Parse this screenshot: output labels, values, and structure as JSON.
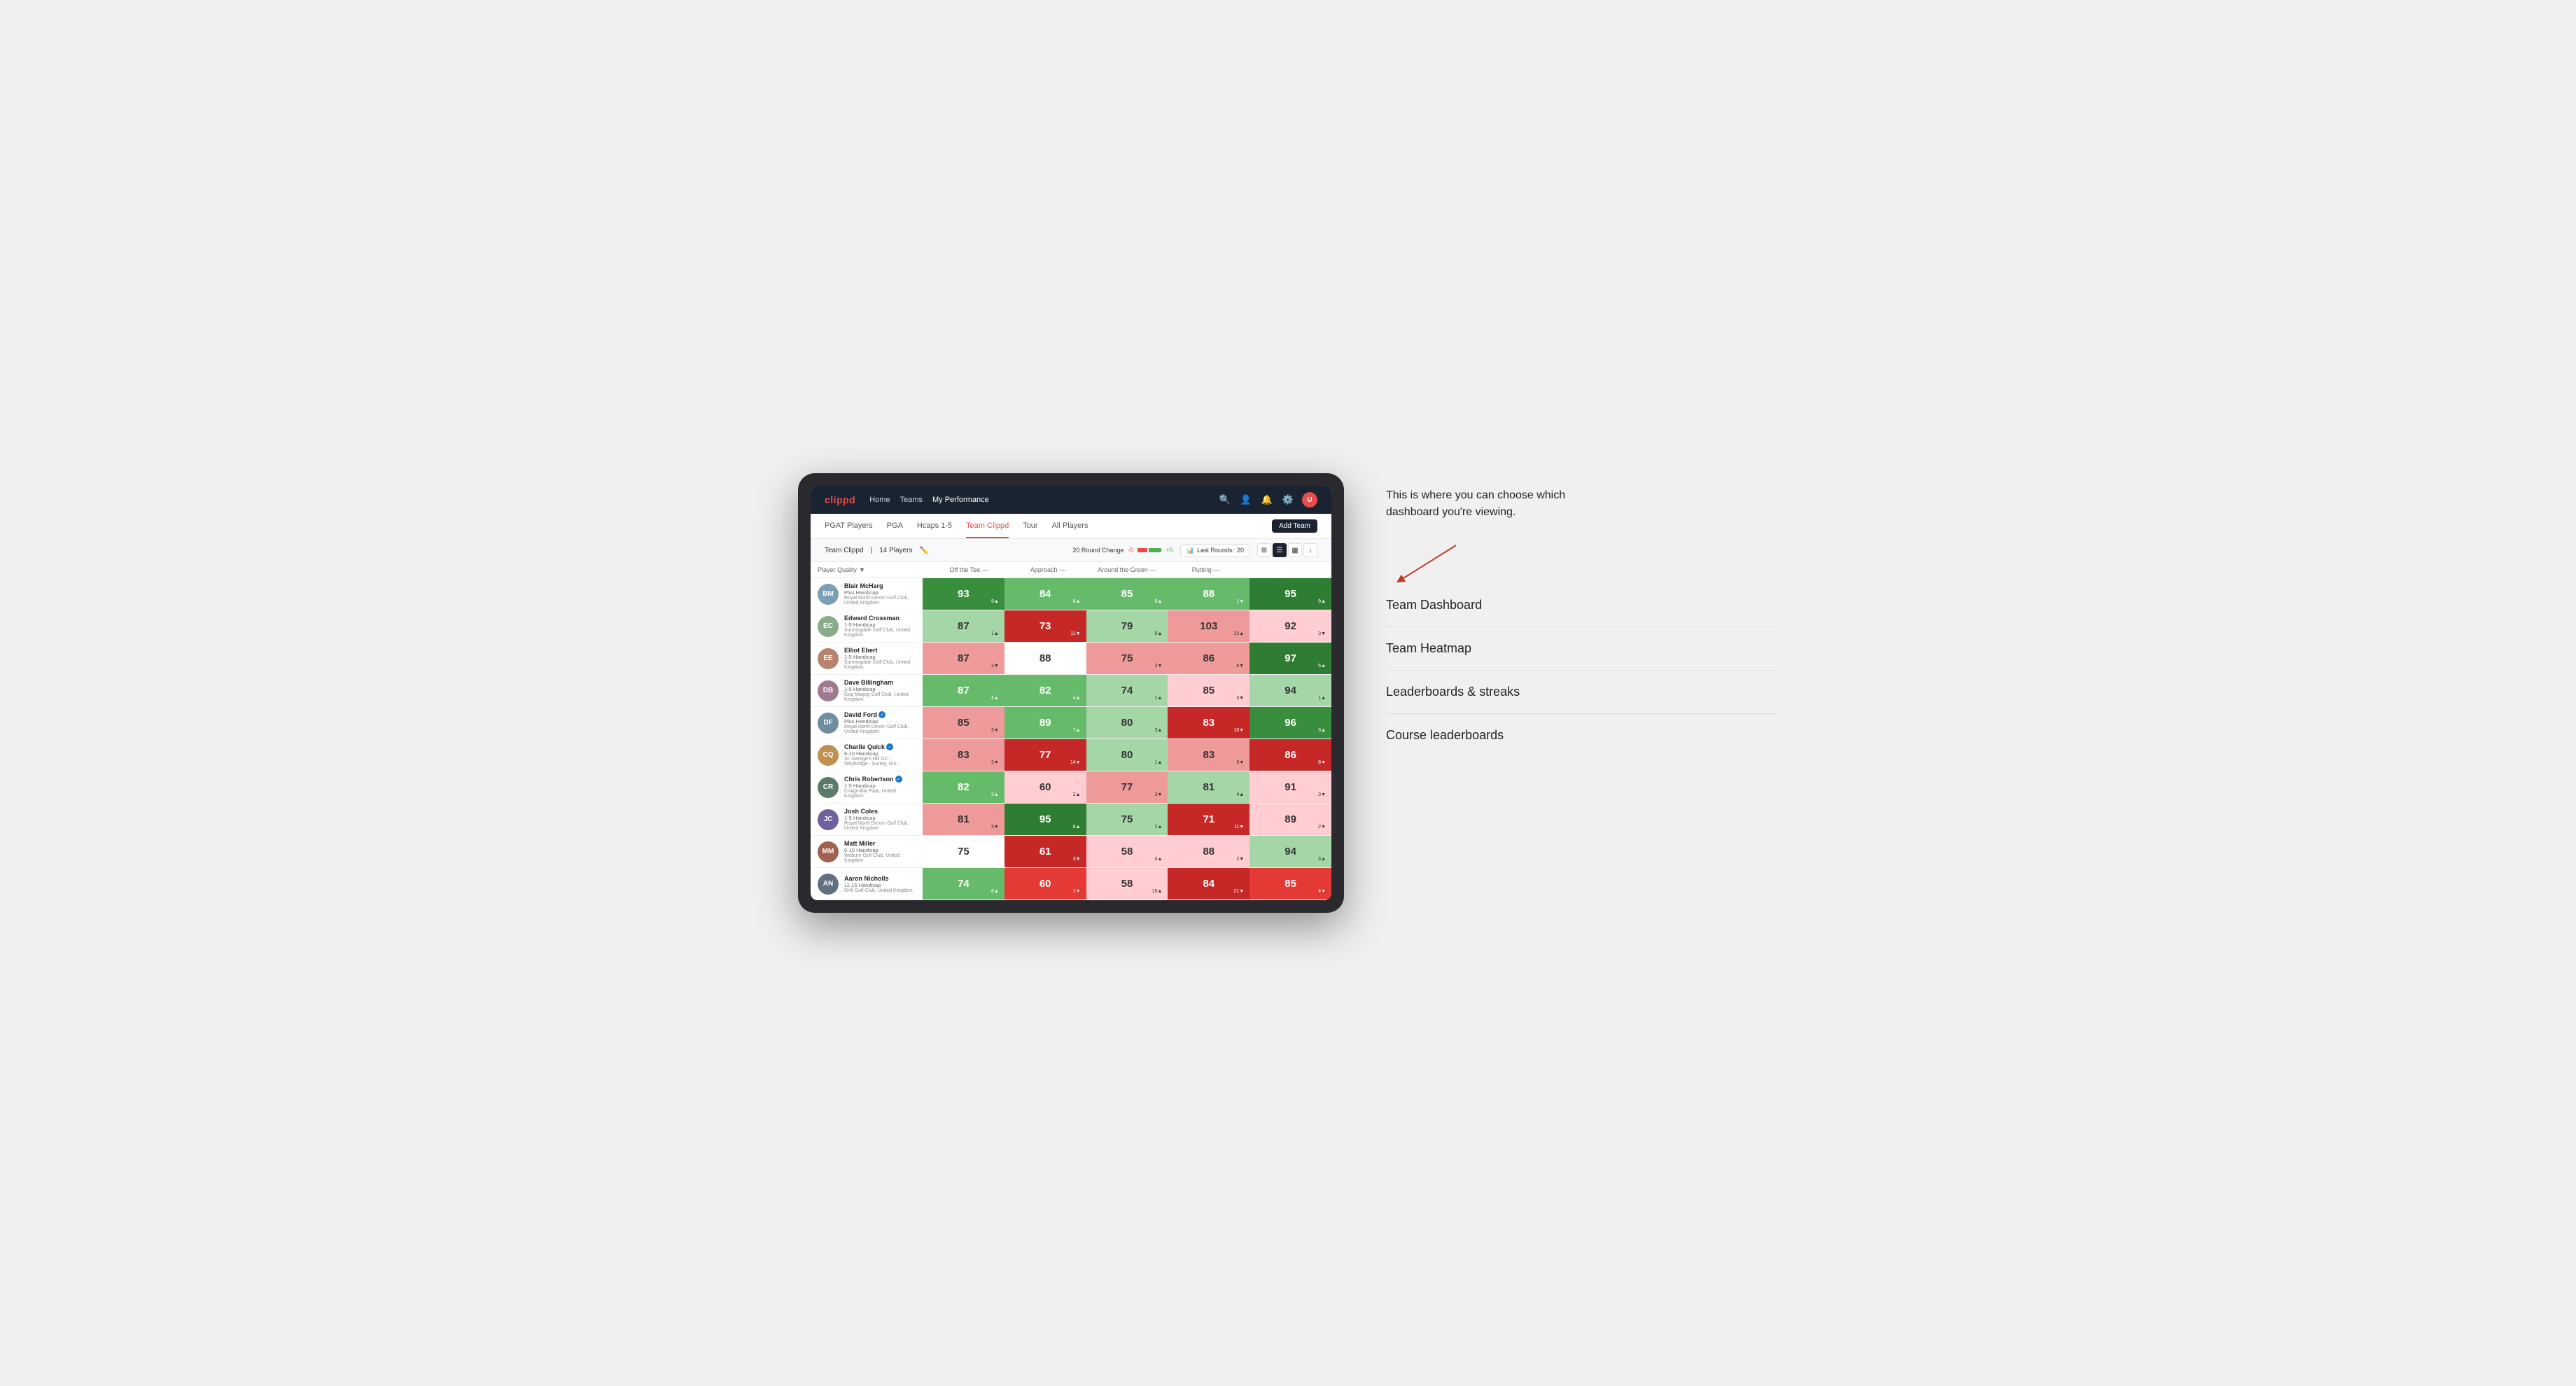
{
  "annotation": {
    "callout": "This is where you can choose which dashboard you're viewing.",
    "arrow_direction": "↘",
    "options": [
      "Team Dashboard",
      "Team Heatmap",
      "Leaderboards & streaks",
      "Course leaderboards"
    ]
  },
  "nav": {
    "logo": "clippd",
    "links": [
      "Home",
      "Teams",
      "My Performance"
    ],
    "active_link": "My Performance"
  },
  "sub_nav": {
    "links": [
      "PGAT Players",
      "PGA",
      "Hcaps 1-5",
      "Team Clippd",
      "Tour",
      "All Players"
    ],
    "active_link": "Team Clippd",
    "add_team_label": "Add Team"
  },
  "team_info": {
    "name": "Team Clippd",
    "player_count": "14 Players",
    "round_change_label": "20 Round Change",
    "change_negative": "-5",
    "change_positive": "+5",
    "last_rounds_label": "Last Rounds:",
    "last_rounds_value": "20"
  },
  "table_headers": {
    "player": "Player Quality",
    "off_tee": "Off the Tee",
    "approach": "Approach",
    "around_green": "Around the Green",
    "putting": "Putting"
  },
  "players": [
    {
      "name": "Blair McHarg",
      "handicap": "Plus Handicap",
      "club": "Royal North Devon Golf Club, United Kingdom",
      "avatar_color": "#7c9fb5",
      "initials": "BM",
      "scores": {
        "quality": {
          "value": 93,
          "change": "+9",
          "trend": "up",
          "color": "green-mid"
        },
        "off_tee": {
          "value": 84,
          "change": "+6",
          "trend": "up",
          "color": "green-light"
        },
        "approach": {
          "value": 85,
          "change": "+8",
          "trend": "up",
          "color": "green-light"
        },
        "around_green": {
          "value": 88,
          "change": "-1",
          "trend": "down",
          "color": "green-light"
        },
        "putting": {
          "value": 95,
          "change": "+9",
          "trend": "up",
          "color": "green-dark"
        }
      }
    },
    {
      "name": "Edward Crossman",
      "handicap": "1-5 Handicap",
      "club": "Sunningdale Golf Club, United Kingdom",
      "avatar_color": "#8aab8a",
      "initials": "EC",
      "scores": {
        "quality": {
          "value": 87,
          "change": "+1",
          "trend": "up",
          "color": "green-pale"
        },
        "off_tee": {
          "value": 73,
          "change": "-11",
          "trend": "down",
          "color": "red-dark"
        },
        "approach": {
          "value": 79,
          "change": "+9",
          "trend": "up",
          "color": "green-pale"
        },
        "around_green": {
          "value": 103,
          "change": "+15",
          "trend": "up",
          "color": "red-light"
        },
        "putting": {
          "value": 92,
          "change": "-3",
          "trend": "down",
          "color": "red-pale"
        }
      }
    },
    {
      "name": "Elliot Ebert",
      "handicap": "1-5 Handicap",
      "club": "Sunningdale Golf Club, United Kingdom",
      "avatar_color": "#b5836e",
      "initials": "EE",
      "scores": {
        "quality": {
          "value": 87,
          "change": "-3",
          "trend": "down",
          "color": "red-light"
        },
        "off_tee": {
          "value": 88,
          "change": "",
          "trend": "",
          "color": "white-cell"
        },
        "approach": {
          "value": 75,
          "change": "-3",
          "trend": "down",
          "color": "red-light"
        },
        "around_green": {
          "value": 86,
          "change": "-6",
          "trend": "down",
          "color": "red-light"
        },
        "putting": {
          "value": 97,
          "change": "+5",
          "trend": "up",
          "color": "green-dark"
        }
      }
    },
    {
      "name": "Dave Billingham",
      "handicap": "1-5 Handicap",
      "club": "Gog Magog Golf Club, United Kingdom",
      "avatar_color": "#a07890",
      "initials": "DB",
      "scores": {
        "quality": {
          "value": 87,
          "change": "+4",
          "trend": "up",
          "color": "green-light"
        },
        "off_tee": {
          "value": 82,
          "change": "+4",
          "trend": "up",
          "color": "green-light"
        },
        "approach": {
          "value": 74,
          "change": "+1",
          "trend": "up",
          "color": "green-pale"
        },
        "around_green": {
          "value": 85,
          "change": "-3",
          "trend": "down",
          "color": "red-pale"
        },
        "putting": {
          "value": 94,
          "change": "+1",
          "trend": "up",
          "color": "green-pale"
        }
      }
    },
    {
      "name": "David Ford",
      "handicap": "Plus Handicap",
      "club": "Royal North Devon Golf Club, United Kingdom",
      "avatar_color": "#6e8ea0",
      "initials": "DF",
      "verified": true,
      "scores": {
        "quality": {
          "value": 85,
          "change": "-3",
          "trend": "down",
          "color": "red-light"
        },
        "off_tee": {
          "value": 89,
          "change": "+7",
          "trend": "up",
          "color": "green-light"
        },
        "approach": {
          "value": 80,
          "change": "+3",
          "trend": "up",
          "color": "green-pale"
        },
        "around_green": {
          "value": 83,
          "change": "-10",
          "trend": "down",
          "color": "red-dark"
        },
        "putting": {
          "value": 96,
          "change": "+3",
          "trend": "up",
          "color": "green-mid"
        }
      }
    },
    {
      "name": "Charlie Quick",
      "handicap": "6-10 Handicap",
      "club": "St. George's Hill GC - Weybridge - Surrey, Uni...",
      "avatar_color": "#c09050",
      "initials": "CQ",
      "verified": true,
      "scores": {
        "quality": {
          "value": 83,
          "change": "-3",
          "trend": "down",
          "color": "red-light"
        },
        "off_tee": {
          "value": 77,
          "change": "-14",
          "trend": "down",
          "color": "red-dark"
        },
        "approach": {
          "value": 80,
          "change": "+1",
          "trend": "up",
          "color": "green-pale"
        },
        "around_green": {
          "value": 83,
          "change": "-6",
          "trend": "down",
          "color": "red-light"
        },
        "putting": {
          "value": 86,
          "change": "-8",
          "trend": "down",
          "color": "red-dark"
        }
      }
    },
    {
      "name": "Chris Robertson",
      "handicap": "1-5 Handicap",
      "club": "Craigmillar Park, United Kingdom",
      "avatar_color": "#5a7a6a",
      "initials": "CR",
      "verified": true,
      "scores": {
        "quality": {
          "value": 82,
          "change": "+3",
          "trend": "up",
          "color": "green-light"
        },
        "off_tee": {
          "value": 60,
          "change": "+2",
          "trend": "up",
          "color": "red-pale"
        },
        "approach": {
          "value": 77,
          "change": "-3",
          "trend": "down",
          "color": "red-light"
        },
        "around_green": {
          "value": 81,
          "change": "+4",
          "trend": "up",
          "color": "green-pale"
        },
        "putting": {
          "value": 91,
          "change": "-3",
          "trend": "down",
          "color": "red-pale"
        }
      }
    },
    {
      "name": "Josh Coles",
      "handicap": "1-5 Handicap",
      "club": "Royal North Devon Golf Club, United Kingdom",
      "avatar_color": "#7060a0",
      "initials": "JC",
      "scores": {
        "quality": {
          "value": 81,
          "change": "-3",
          "trend": "down",
          "color": "red-light"
        },
        "off_tee": {
          "value": 95,
          "change": "+8",
          "trend": "up",
          "color": "green-dark"
        },
        "approach": {
          "value": 75,
          "change": "+2",
          "trend": "up",
          "color": "green-pale"
        },
        "around_green": {
          "value": 71,
          "change": "-11",
          "trend": "down",
          "color": "red-dark"
        },
        "putting": {
          "value": 89,
          "change": "-2",
          "trend": "down",
          "color": "red-pale"
        }
      }
    },
    {
      "name": "Matt Miller",
      "handicap": "6-10 Handicap",
      "club": "Woburn Golf Club, United Kingdom",
      "avatar_color": "#a06050",
      "initials": "MM",
      "scores": {
        "quality": {
          "value": 75,
          "change": "",
          "trend": "",
          "color": "white-cell"
        },
        "off_tee": {
          "value": 61,
          "change": "-3",
          "trend": "down",
          "color": "red-dark"
        },
        "approach": {
          "value": 58,
          "change": "+4",
          "trend": "up",
          "color": "red-pale"
        },
        "around_green": {
          "value": 88,
          "change": "-2",
          "trend": "down",
          "color": "red-pale"
        },
        "putting": {
          "value": 94,
          "change": "+3",
          "trend": "up",
          "color": "green-pale"
        }
      }
    },
    {
      "name": "Aaron Nicholls",
      "handicap": "11-15 Handicap",
      "club": "Drift Golf Club, United Kingdom",
      "avatar_color": "#607080",
      "initials": "AN",
      "scores": {
        "quality": {
          "value": 74,
          "change": "+8",
          "trend": "up",
          "color": "green-light"
        },
        "off_tee": {
          "value": 60,
          "change": "-1",
          "trend": "down",
          "color": "red-mid"
        },
        "approach": {
          "value": 58,
          "change": "+10",
          "trend": "up",
          "color": "red-pale"
        },
        "around_green": {
          "value": 84,
          "change": "-21",
          "trend": "down",
          "color": "red-dark"
        },
        "putting": {
          "value": 85,
          "change": "-4",
          "trend": "down",
          "color": "red-mid"
        }
      }
    }
  ]
}
